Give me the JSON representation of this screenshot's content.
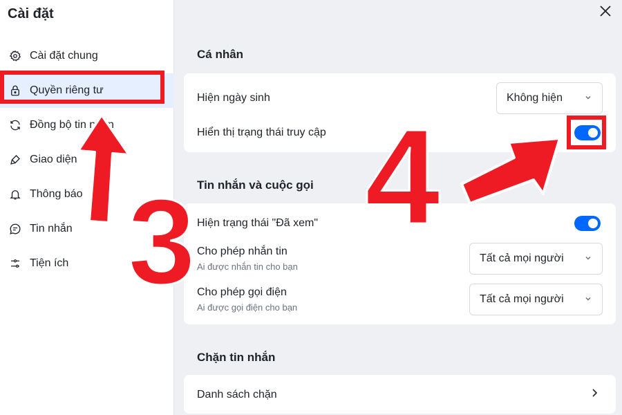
{
  "sidebar": {
    "title": "Cài đặt",
    "items": [
      {
        "label": "Cài đặt chung",
        "icon": "gear-icon"
      },
      {
        "label": "Quyền riêng tư",
        "icon": "lock-icon"
      },
      {
        "label": "Đồng bộ tin nhắn",
        "icon": "sync-icon"
      },
      {
        "label": "Giao diện",
        "icon": "brush-icon"
      },
      {
        "label": "Thông báo",
        "icon": "bell-icon"
      },
      {
        "label": "Tin nhắn",
        "icon": "message-icon"
      },
      {
        "label": "Tiện ích",
        "icon": "sliders-icon"
      }
    ],
    "active_index": 1
  },
  "main": {
    "personal": {
      "title": "Cá nhân",
      "birthday_label": "Hiện ngày sinh",
      "birthday_value": "Không hiện",
      "status_label": "Hiển thị trạng thái truy cập",
      "status_on": true
    },
    "messaging": {
      "title": "Tin nhắn và cuộc gọi",
      "seen_label": "Hiện trạng thái \"Đã xem\"",
      "seen_on": true,
      "allow_msg_label": "Cho phép nhắn tin",
      "allow_msg_sub": "Ai được nhắn tin cho bạn",
      "allow_msg_value": "Tất cả mọi người",
      "allow_call_label": "Cho phép gọi điện",
      "allow_call_sub": "Ai được gọi điện cho bạn",
      "allow_call_value": "Tất cả mọi người"
    },
    "block": {
      "title": "Chặn tin nhắn",
      "list_label": "Danh sách chặn"
    }
  },
  "annotations": {
    "step3": "3",
    "step4": "4",
    "color": "#ee1a24"
  },
  "colors": {
    "accent": "#0068ff",
    "active_bg": "#e5efff"
  }
}
